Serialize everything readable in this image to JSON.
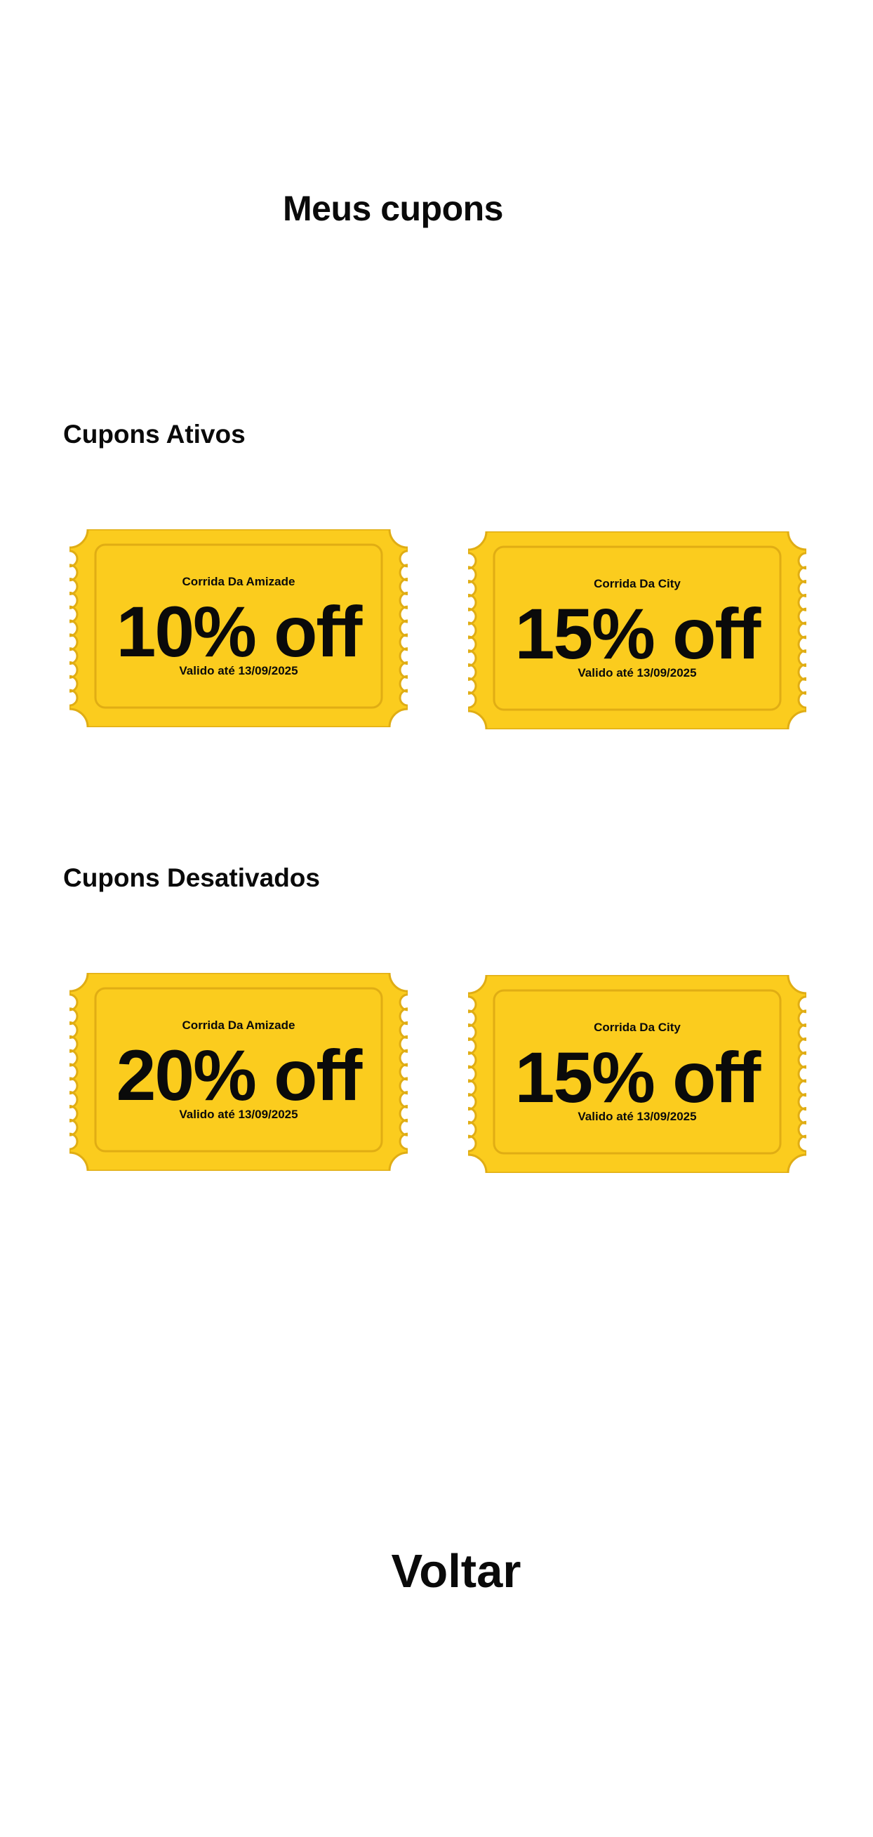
{
  "header": {
    "title": "Meus cupons"
  },
  "sections": {
    "ativos": {
      "title": "Cupons Ativos",
      "coupons": [
        {
          "name": "Corrida Da Amizade",
          "discount": "10% off",
          "valid": "Valido até 13/09/2025"
        },
        {
          "name": "Corrida Da City",
          "discount": "15% off",
          "valid": "Valido até 13/09/2025"
        }
      ]
    },
    "desativados": {
      "title": "Cupons Desativados",
      "coupons": [
        {
          "name": "Corrida Da Amizade",
          "discount": "20% off",
          "valid": "Valido até 13/09/2025"
        },
        {
          "name": "Corrida Da City",
          "discount": "15% off",
          "valid": "Valido até 13/09/2025"
        }
      ]
    }
  },
  "footer": {
    "back_label": "Voltar"
  },
  "colors": {
    "ticket": "#fbcc1e",
    "ticket_border": "#e0ad14",
    "text": "#0a0a0a"
  }
}
